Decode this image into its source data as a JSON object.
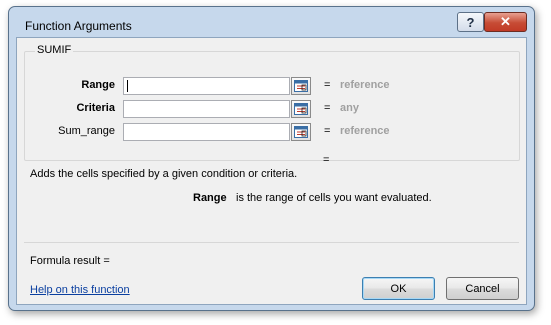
{
  "dialog": {
    "title": "Function Arguments",
    "help_glyph": "?",
    "close_glyph": "✕"
  },
  "function_group": {
    "name": "SUMIF",
    "arguments": [
      {
        "label": "Range",
        "value": "",
        "equals": "=",
        "hint": "reference"
      },
      {
        "label": "Criteria",
        "value": "",
        "equals": "=",
        "hint": "any"
      },
      {
        "label": "Sum_range",
        "value": "",
        "equals": "=",
        "hint": "reference"
      }
    ],
    "result_equals": "="
  },
  "description": {
    "function_text": "Adds the cells specified by a given condition or criteria.",
    "argument_name": "Range",
    "argument_text": "is the range of cells you want evaluated."
  },
  "formula_result_label": "Formula result =",
  "help_link_text": "Help on this function",
  "buttons": {
    "ok": "OK",
    "cancel": "Cancel"
  },
  "icons": {
    "title_help": "help-icon",
    "title_close": "close-icon",
    "collapse": "collapse-dialog-icon"
  }
}
